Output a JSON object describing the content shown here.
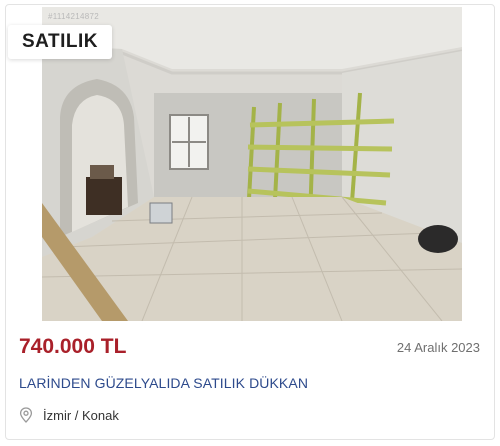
{
  "listing": {
    "id_watermark": "#1114214872",
    "badge": "SATILIK",
    "price": "740.000 TL",
    "date": "24 Aralık 2023",
    "title": "LARİNDEN GÜZELYALIDA SATILIK DÜKKAN",
    "location": "İzmir / Konak"
  },
  "icons": {
    "location": "location-pin-icon"
  },
  "colors": {
    "price": "#a9202a",
    "title": "#2d4a8c",
    "date": "#6f6f6f"
  }
}
